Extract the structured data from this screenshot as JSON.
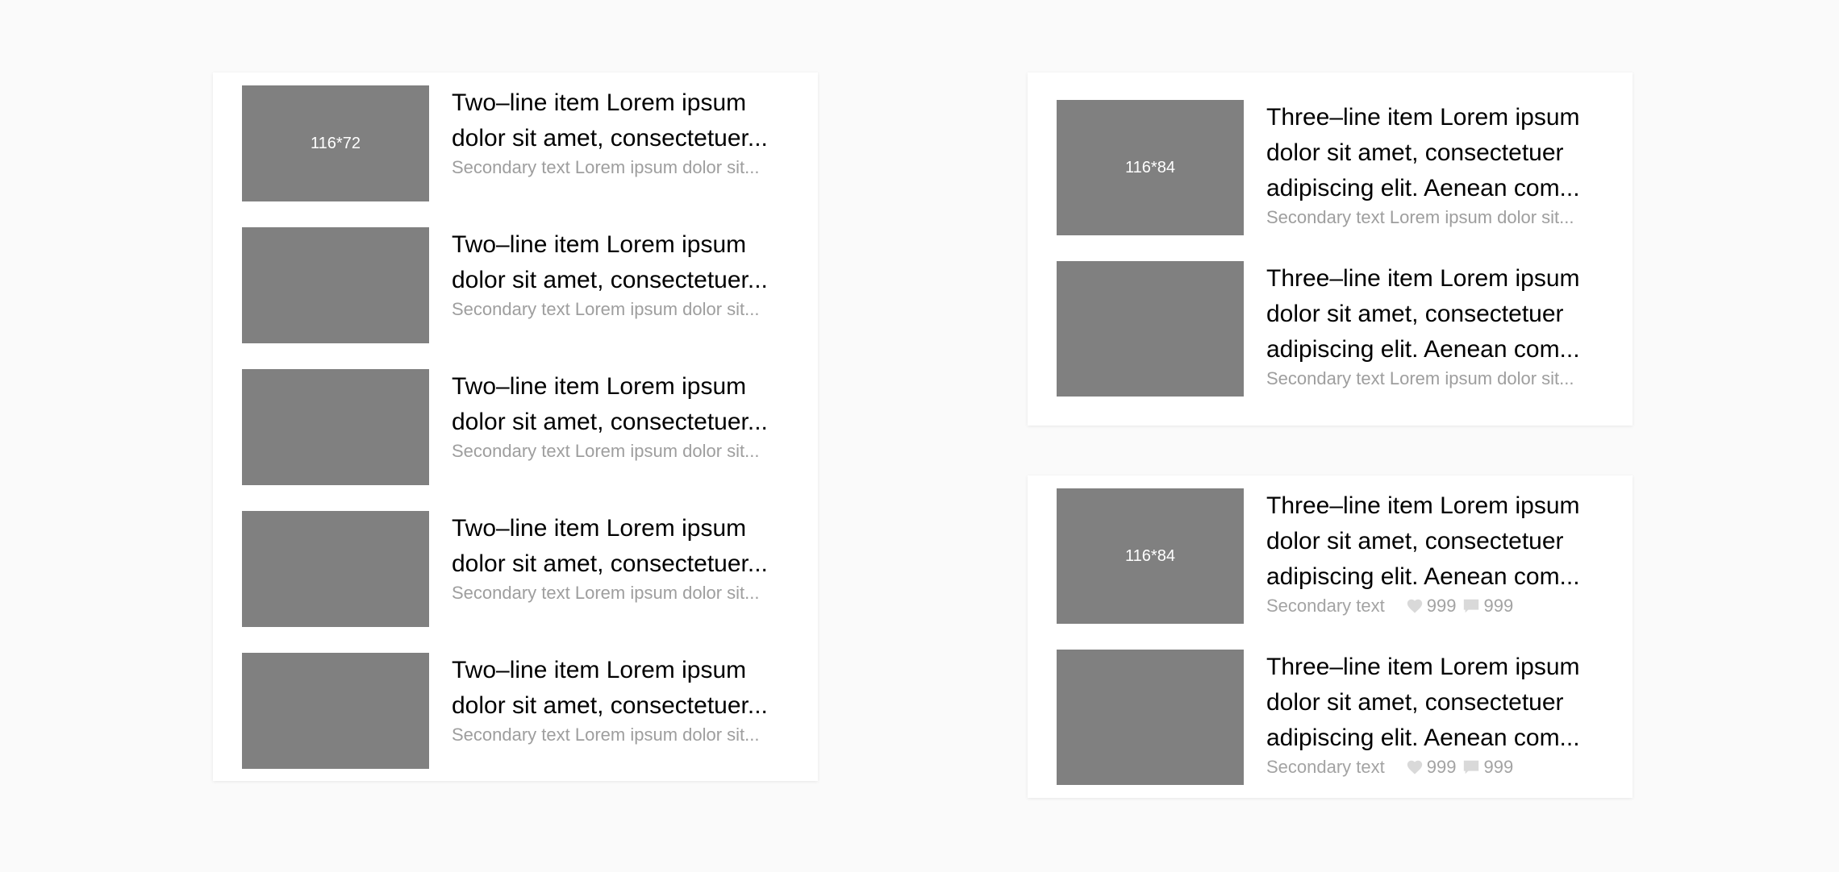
{
  "left_card": {
    "thumb_label": "116*72",
    "items": [
      {
        "title_l1": "Two–line item Lorem ipsum",
        "title_l2": "dolor sit amet, consectetuer...",
        "secondary": "Secondary text Lorem ipsum dolor sit..."
      },
      {
        "title_l1": "Two–line item Lorem ipsum",
        "title_l2": "dolor sit amet, consectetuer...",
        "secondary": "Secondary text Lorem ipsum dolor sit..."
      },
      {
        "title_l1": "Two–line item Lorem ipsum",
        "title_l2": "dolor sit amet, consectetuer...",
        "secondary": "Secondary text Lorem ipsum dolor sit..."
      },
      {
        "title_l1": "Two–line item Lorem ipsum",
        "title_l2": "dolor sit amet, consectetuer...",
        "secondary": "Secondary text Lorem ipsum dolor sit..."
      },
      {
        "title_l1": "Two–line item Lorem ipsum",
        "title_l2": "dolor sit amet, consectetuer...",
        "secondary": "Secondary text Lorem ipsum dolor sit..."
      }
    ]
  },
  "right_top_card": {
    "thumb_label": "116*84",
    "items": [
      {
        "title_l1": "Three–line item Lorem ipsum",
        "title_l2": "dolor sit amet, consectetuer",
        "title_l3": "adipiscing elit. Aenean com...",
        "secondary": "Secondary text Lorem ipsum dolor sit..."
      },
      {
        "title_l1": "Three–line item Lorem ipsum",
        "title_l2": "dolor sit amet, consectetuer",
        "title_l3": "adipiscing elit. Aenean com...",
        "secondary": "Secondary text Lorem ipsum dolor sit..."
      }
    ]
  },
  "right_bottom_card": {
    "thumb_label": "116*84",
    "items": [
      {
        "title_l1": "Three–line item Lorem ipsum",
        "title_l2": "dolor sit amet, consectetuer",
        "title_l3": "adipiscing elit. Aenean com...",
        "secondary": "Secondary text",
        "likes": "999",
        "comments": "999"
      },
      {
        "title_l1": "Three–line item Lorem ipsum",
        "title_l2": "dolor sit amet, consectetuer",
        "title_l3": "adipiscing elit. Aenean com...",
        "secondary": "Secondary text",
        "likes": "999",
        "comments": "999"
      }
    ]
  },
  "icons": {
    "like": "heart-icon",
    "comment": "comment-icon"
  },
  "colors": {
    "background": "#fafafa",
    "card": "#ffffff",
    "thumbnail": "#808080",
    "primary_text": "#000000",
    "secondary_text": "#9e9e9e",
    "icon": "#d9d9d9"
  }
}
